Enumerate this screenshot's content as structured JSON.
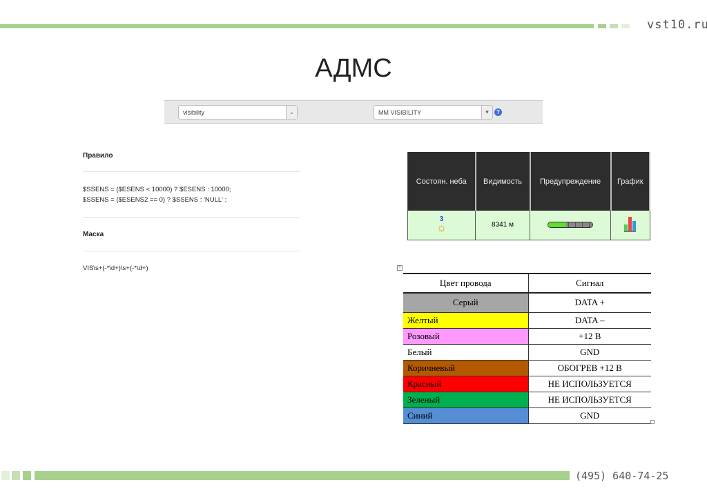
{
  "site": "vst10.ru",
  "title": "АДМС",
  "toolbar": {
    "field1": "visibility",
    "field2": "MM VISIBILITY",
    "help": "?"
  },
  "rule": {
    "label": "Правило",
    "lines": [
      "$SSENS = ($ESENS < 10000) ? $ESENS : 10000;",
      "$SSENS = ($ESENS2 == 0) ? $SSENS : 'NULL' ;"
    ]
  },
  "mask": {
    "label": "Маска",
    "value": "VIS\\s+(-*\\d+)\\s+(-*\\d+)"
  },
  "weather": {
    "headers": [
      "Состоян. неба",
      "Видимость",
      "Предупреждение",
      "График"
    ],
    "sky_value": "3",
    "visibility": "8341 м",
    "warning_level": 0.4
  },
  "wires": {
    "headers": [
      "Цвет провода",
      "Сигнал"
    ],
    "rows": [
      {
        "color": "Серый",
        "signal": "DATA +",
        "bg": "#a6a6a6"
      },
      {
        "color": "Желтый",
        "signal": "DATA –",
        "bg": "#ffff00"
      },
      {
        "color": "Розовый",
        "signal": "+12 В",
        "bg": "#ff99ff"
      },
      {
        "color": "Белый",
        "signal": "GND",
        "bg": "#ffffff"
      },
      {
        "color": "Коричневый",
        "signal": "ОБОГРЕВ +12 В",
        "bg": "#b35900"
      },
      {
        "color": "Красный",
        "signal": "НЕ ИСПОЛЬЗУЕТСЯ",
        "bg": "#ff0000"
      },
      {
        "color": "Зеленый",
        "signal": "НЕ ИСПОЛЬЗУЕТСЯ",
        "bg": "#00b050"
      },
      {
        "color": "Синий",
        "signal": "GND",
        "bg": "#558ed5"
      }
    ]
  },
  "phone": "(495) 640-74-25"
}
